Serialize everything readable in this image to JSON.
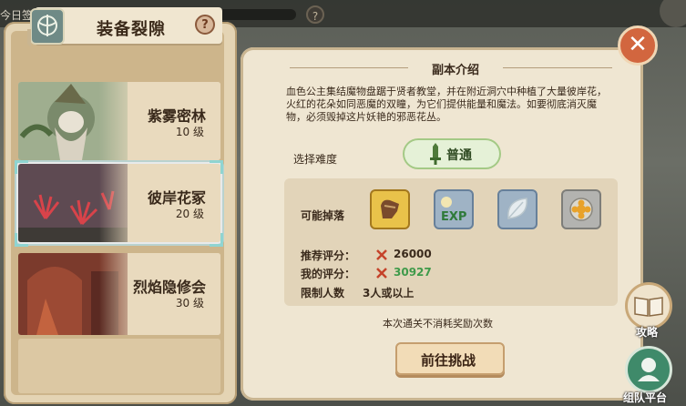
{
  "background": {
    "today_text": "今日签"
  },
  "panel": {
    "title": "装备裂隙",
    "help_glyph": "?"
  },
  "dungeons": [
    {
      "name": "紫雾密林",
      "level": "10 级"
    },
    {
      "name": "彼岸花冢",
      "level": "20 级"
    },
    {
      "name": "烈焰隐修会",
      "level": "30 级"
    }
  ],
  "selected_index": 1,
  "detail": {
    "section_title": "副本介绍",
    "description": "血色公主集结魔物盘踞于贤者教堂，并在附近洞穴中种植了大量彼岸花，火红的花朵如同恶魔的双瞳，为它们提供能量和魔法。如要彻底消灭魔物，必须毁掉这片妖艳的邪恶花丛。",
    "difficulty_label": "选择难度",
    "difficulty_value": "普通",
    "drops_label": "可能掉落",
    "drops": [
      {
        "icon": "gauntlet-icon"
      },
      {
        "icon": "exp-icon"
      },
      {
        "icon": "leaf-icon"
      },
      {
        "icon": "flower-coin-icon"
      }
    ],
    "recommended_label": "推荐评分：",
    "recommended_value": "26000",
    "my_score_label": "我的评分：",
    "my_score_value": "30927",
    "limit_label": "限制人数",
    "limit_value": "3人或以上",
    "note": "本次通关不消耗奖励次数",
    "go_button": "前往挑战"
  },
  "side": {
    "guide_label": "攻略",
    "team_label": "组队平台"
  },
  "colors": {
    "my_score": "#3f9a4a",
    "accent": "#d2663f",
    "selection": "#8fd4d1"
  }
}
